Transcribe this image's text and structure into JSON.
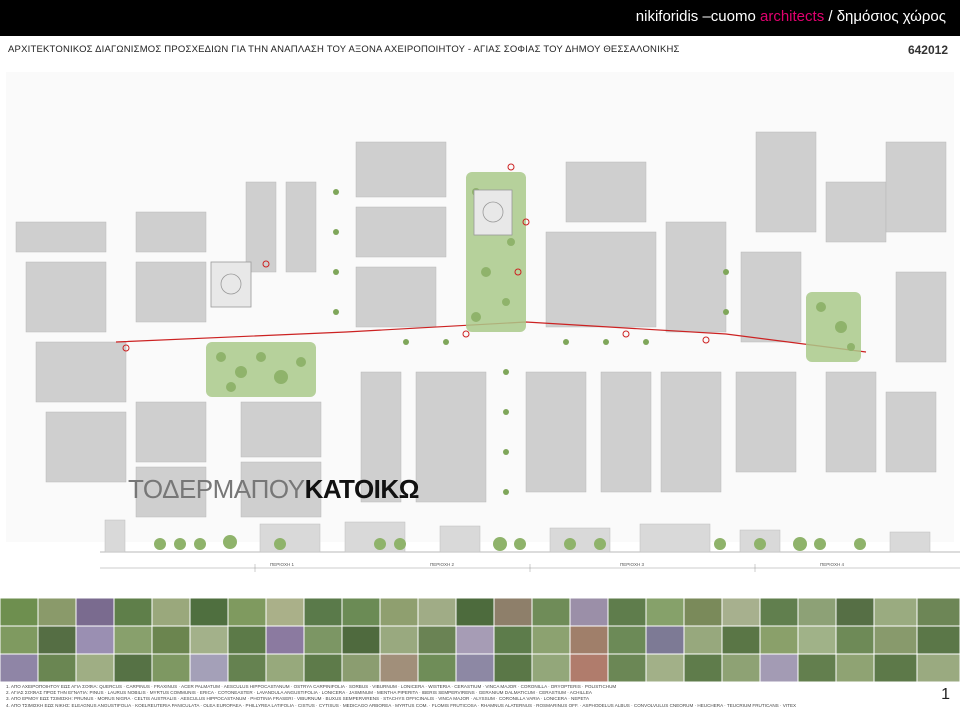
{
  "header": {
    "brand_main": "nikiforidis –cuomo ",
    "brand_accent": "architects",
    "brand_section": " / δημόσιος χώρος"
  },
  "slide": {
    "title": "ΑΡΧΙΤΕΚΤΟΝΙΚΟΣ ΔΙΑΓΩΝΙΣΜΟΣ ΠΡΟΣΧΕΔΙΩΝ ΓΙΑ ΤΗΝ ΑΝΑΠΛΑΣΗ ΤΟΥ ΑΞΟΝΑ ΑΧΕΙΡΟΠΟΙΗΤΟΥ  - ΑΓΙΑΣ ΣΟΦΙΑΣ ΤΟΥ ΔΗΜΟΥ ΘΕΣΣΑΛΟΝΙΚΗΣ",
    "code": "642012",
    "tagline_light": "ΤΟΔΕΡΜΑΠΟΥ",
    "tagline_bold": "ΚΑΤΟΙΚΩ",
    "zones": [
      "ΠΕΡΙΟΧΗ 1",
      "ΠΕΡΙΟΧΗ 2",
      "ΠΕΡΙΟΧΗ 3",
      "ΠΕΡΙΟΧΗ 4"
    ],
    "page_number": "1"
  },
  "notes": [
    "1. ΑΠΟ ΑΧΕΙΡΟΠΟΙΗΤΟΥ ΕΩΣ ΑΓΙΑ ΣΟΦΙΑ: QUERCUS · CARPINUS · FRAXINUS · ACER PALMATUM · AESCULUS HIPPOCASTANUM · OSTRYA CARPINIFOLIA · SORBUS · VIBURNUM · LONICERA · WISTERIA · CERASTIUM · VINCA MAJOR · CORONILLA · DRYOPTERIS · POLISTICHUM",
    "2. ΑΓΙΑΣ ΣΟΦΙΑΣ ΠΡΟΣ ΤΗΝ ΕΓΝΑΤΙΑ: PINUS · LAURUS NOBILIS · MYRTUS COMMUNIS · ERICA · COTONEASTER · LAVANDULA ANGUSTIFOLIA · LONICERA · JASMINUM · MENTHA PIPERITA · IBERIS SEMPERVIRENS · GERANIUM DALMATICUM · CERASTIUM · ACHILLEA",
    "3. ΑΠΟ ΕΡΜΟΥ ΕΩΣ ΤΣΙΜΙΣΚΗ: PRUNUS · MORUS NIGRA · CELTIS AUSTRALIS · AESCULUS HIPPOCASTANUM · PHOTINIA FRASERI · VIBURNUM · BUXUS SEMPERVIRENS · STACHYS OFFICINALIS · VINCA MAJOR · ALYSSUM · CORONILLA VARIA · LONICERA · NEPETA",
    "4. ΑΠΟ ΤΣΙΜΙΣΚΗ ΕΩΣ ΝΙΚΗΣ: ELEAGNUS ANGUSTIFOLIA · KOELREUTERIA PANICULATA · OLEA EUROPAEA · PHILLYREA LATIFOLIA · CISTUS · CYTISUS · MEDICAGO ARBOREA · MYRTUS COM. · FLOMIS FRUTICOSA · RHAMNUS ALATERNUS · ROSMARINUS OFF. · ASPHODELUS ALBUS · CONVOLVULUS CNEORUM · HEUCHERA · TEUCRIUM FRUTICANS · VITEX"
  ],
  "colors": {
    "accent": "#e0006e",
    "building": "#c8c8c8",
    "tree": "#9fbf7a",
    "marker": "#cc2222"
  }
}
